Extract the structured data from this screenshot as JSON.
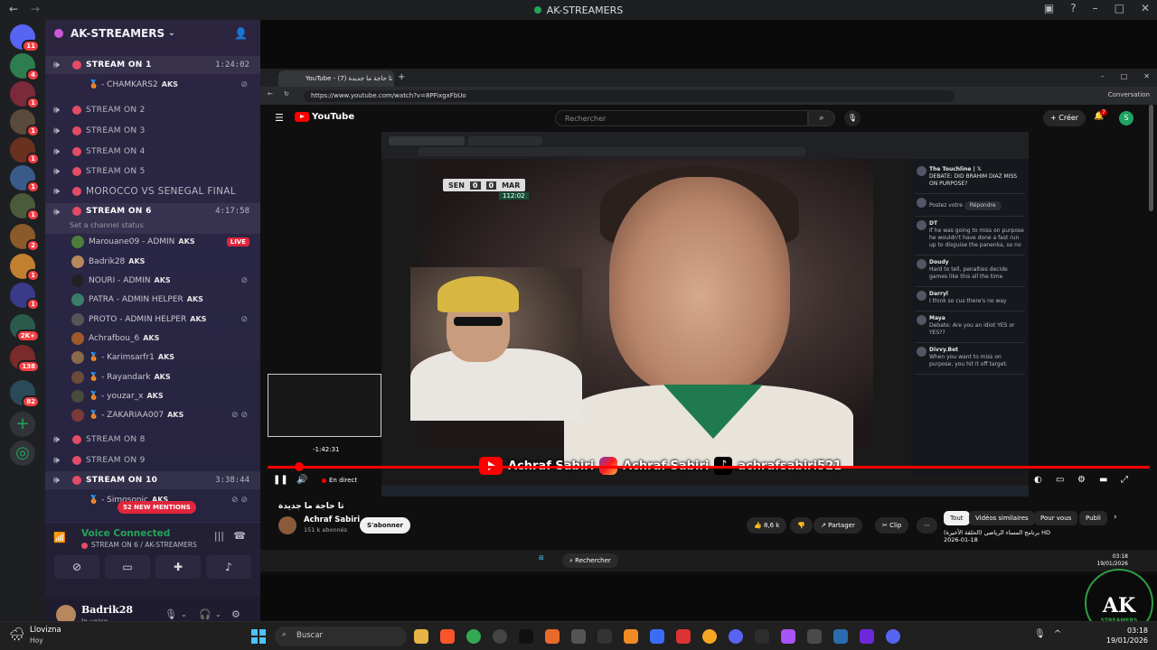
{
  "titlebar": {
    "title": "AK-STREAMERS",
    "back": "←",
    "forward": "→"
  },
  "rail": {
    "badges": [
      "11",
      "4",
      "1",
      "1",
      "1",
      "1",
      "1",
      "2",
      "1",
      "1",
      "2K+",
      "138",
      "82"
    ]
  },
  "server": {
    "name": "AK-STREAMERS"
  },
  "channels": [
    {
      "name": "STREAM ON 1",
      "time": "1:24:02",
      "active": true
    },
    {
      "name": "STREAM ON 2"
    },
    {
      "name": "STREAM ON 3"
    },
    {
      "name": "STREAM ON 4"
    },
    {
      "name": "STREAM ON 5"
    },
    {
      "name": "MOROCCO VS SENEGAL FINAL",
      "big": true
    },
    {
      "name": "STREAM ON 6",
      "time": "4:17:58",
      "active": true,
      "status": "Set a channel status"
    },
    {
      "name": "STREAM ON 8"
    },
    {
      "name": "STREAM ON 9"
    },
    {
      "name": "STREAM ON 10",
      "time": "3:38:44",
      "active": true
    }
  ],
  "ch1_user": {
    "name": "🥉 - CHAMKARS2",
    "tag": "AKS"
  },
  "ch6_users": [
    {
      "name": "Marouane09 - ADMIN",
      "tag": "AKS",
      "live": "LIVE"
    },
    {
      "name": "Badrik28",
      "tag": "AKS"
    },
    {
      "name": "NOURI - ADMIN",
      "tag": "AKS"
    },
    {
      "name": "PATRA - ADMIN HELPER",
      "tag": "AKS"
    },
    {
      "name": "PROTO - ADMIN HELPER",
      "tag": "AKS"
    },
    {
      "name": "Achrafbou_6",
      "tag": "AKS"
    },
    {
      "name": "🥉 - Karimsarfr1",
      "tag": "AKS"
    },
    {
      "name": "🥉 - Rayandark",
      "tag": "AKS"
    },
    {
      "name": "🥉 - youzar_x",
      "tag": "AKS"
    },
    {
      "name": "🥉 - ZAKARIAA007",
      "tag": "AKS"
    }
  ],
  "ch10_user": {
    "name": "🥉 - Simosonic",
    "tag": "AKS"
  },
  "mentions": "52 NEW MENTIONS",
  "voice": {
    "title": "Voice Connected",
    "channel": "STREAM ON 6 / AK-STREAMERS"
  },
  "me": {
    "name": "Badrik28",
    "status": "In voice"
  },
  "browser": {
    "tab_title": "YouTube - تا حاجة ما جديدة (7)",
    "url": "https://www.youtube.com/watch?v=8PFixgxFbUo",
    "conversation": "Conversation"
  },
  "youtube": {
    "logo": "YouTube",
    "search_placeholder": "Rechercher",
    "create": "Créer",
    "notif_count": "7",
    "account": "S"
  },
  "player": {
    "score_home": "SEN",
    "score_h": "0",
    "score_a": "0",
    "score_away": "MAR",
    "match_clock": "112:02",
    "preview_time": "-1:42:31",
    "live_label": "En direct",
    "banner_1": "Achraf Sabiri",
    "banner_2": "Achraf Sabiri",
    "banner_3": "achrafsabiri521",
    "tweet_head": "The Touchline | 𝕏",
    "tweet_text": "DEBATE: DID BRAHIM DIAZ MISS ON PURPOSE?",
    "tweet_reply": "Postez votre",
    "tweet_reply_btn": "Répondre",
    "tweets": [
      {
        "h": "DT",
        "t": "If he was going to miss on purpose he wouldn't have done a fast run up to disguise the panenka, so no"
      },
      {
        "h": "Doudy",
        "t": "Hard to tell, penalties decide games like this all the time"
      },
      {
        "h": "Darryl",
        "t": "I think so cus there's no way"
      },
      {
        "h": "Maya",
        "t": "Debate: Are you an idiot YES or YES??"
      },
      {
        "h": "Divvy.Bet",
        "t": "When you want to miss on purpose, you hit it off target."
      }
    ]
  },
  "video": {
    "title": "تا حاجة ما جديدة",
    "channel": "Achraf Sabiri",
    "subs": "151 k abonnés",
    "subscribe": "S'abonner",
    "likes": "8,6 k",
    "share": "Partager",
    "clip": "Clip",
    "chips": [
      "Tout",
      "Vidéos similaires",
      "Pour vous",
      "Publi"
    ],
    "rec_title": "برنامج المساء الرياضي (الحلقة الأخيرة) HD",
    "rec_date": "2026-01-18"
  },
  "inner_taskbar": {
    "search": "Rechercher",
    "time": "03:18",
    "date": "19/01/2026"
  },
  "ak_logo": {
    "text": "AK",
    "sub": "STREAMERS"
  },
  "taskbar": {
    "weather": "Llovizna",
    "weather_sub": "Hoy",
    "search": "Buscar",
    "time": "03:18",
    "date": "19/01/2026"
  }
}
